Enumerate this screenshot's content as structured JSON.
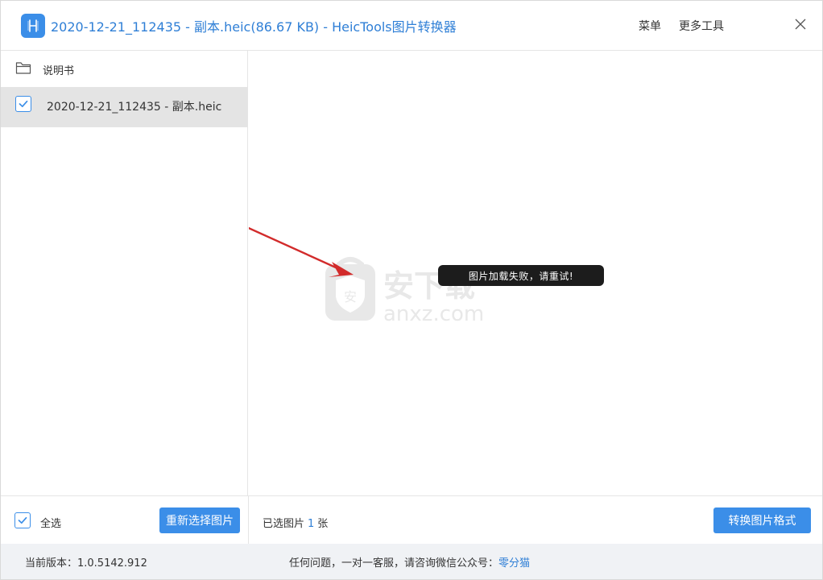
{
  "window": {
    "title": "2020-12-21_112435 - 副本.heic(86.67 KB) - HeicTools图片转换器",
    "menu_label": "菜单",
    "more_tools_label": "更多工具"
  },
  "sidebar": {
    "folder_label": "说明书",
    "files": [
      {
        "name": "2020-12-21_112435 - 副本.heic",
        "checked": true
      }
    ]
  },
  "preview": {
    "error_message": "图片加载失败，请重试!",
    "watermark_main": "安下载",
    "watermark_sub": "anxz.com"
  },
  "bottom": {
    "select_all_label": "全选",
    "reselect_button": "重新选择图片",
    "selected_prefix": "已选图片",
    "selected_count": "1",
    "selected_suffix": "张",
    "convert_button": "转换图片格式"
  },
  "status": {
    "version_text": "当前版本：1.0.5142.912",
    "support_text": "任何问题，一对一客服，请咨询微信公众号：",
    "support_link": "零分猫"
  },
  "colors": {
    "accent": "#3b8ee8",
    "title_text": "#2f7fd6",
    "selected_row": "#e4e4e4",
    "status_bg": "#f0f2f5",
    "toast_bg": "#1c1c1c",
    "annotation_arrow": "#d22b2b"
  }
}
